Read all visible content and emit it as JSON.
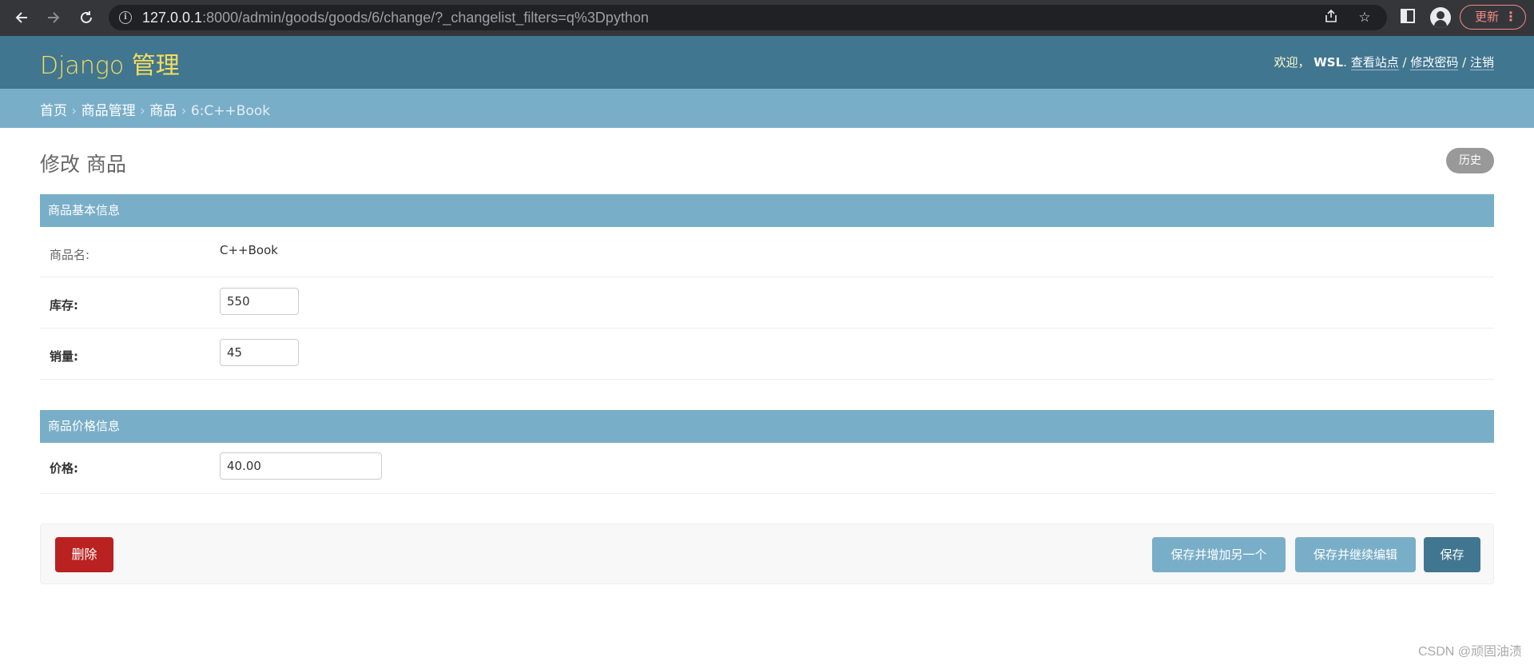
{
  "browser": {
    "url_host": "127.0.0.1",
    "url_rest": ":8000/admin/goods/goods/6/change/?_changelist_filters=q%3Dpython",
    "update_label": "更新"
  },
  "header": {
    "branding": "Django 管理",
    "welcome": "欢迎，",
    "username": "WSL",
    "view_site": "查看站点",
    "change_password": "修改密码",
    "logout": "注销",
    "separator": "/"
  },
  "breadcrumbs": {
    "home": "首页",
    "app": "商品管理",
    "model": "商品",
    "current": "6:C++Book",
    "sep": "›"
  },
  "content": {
    "title": "修改 商品",
    "history": "历史"
  },
  "fieldsets": [
    {
      "title": "商品基本信息",
      "fields": [
        {
          "label": "商品名:",
          "value": "C++Book",
          "readonly": true
        },
        {
          "label": "库存:",
          "value": "550",
          "readonly": false
        },
        {
          "label": "销量:",
          "value": "45",
          "readonly": false
        }
      ]
    },
    {
      "title": "商品价格信息",
      "fields": [
        {
          "label": "价格:",
          "value": "40.00",
          "readonly": false
        }
      ]
    }
  ],
  "submit_row": {
    "delete": "删除",
    "save_add_another": "保存并增加另一个",
    "save_continue": "保存并继续编辑",
    "save": "保存"
  },
  "watermark": "CSDN @顽固油渍",
  "colors": {
    "header": "#417690",
    "breadcrumbs": "#79aec8",
    "branding": "#f5dd5d",
    "delete": "#ba2121"
  }
}
